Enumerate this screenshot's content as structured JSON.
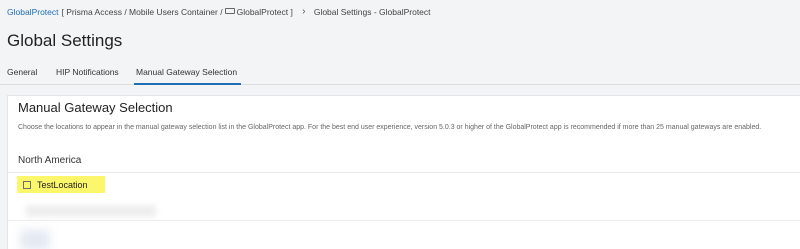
{
  "breadcrumb": {
    "root": "GlobalProtect",
    "path_start": "[ Prisma Access / Mobile Users Container /",
    "path_end": "GlobalProtect ]",
    "current": "Global Settings - GlobalProtect"
  },
  "page": {
    "title": "Global Settings"
  },
  "tabs": [
    {
      "label": "General"
    },
    {
      "label": "HIP Notifications"
    },
    {
      "label": "Manual Gateway Selection"
    }
  ],
  "section": {
    "title": "Manual Gateway Selection",
    "description": "Choose the locations to appear in the manual gateway selection list in the GlobalProtect app. For the best end user experience, version 5.0.3 or higher of the GlobalProtect app is recommended if more than 25 manual gateways are enabled.",
    "region": "North America",
    "locations": [
      {
        "label": "TestLocation",
        "checked": false
      }
    ]
  },
  "colors": {
    "link": "#1f6fb5",
    "highlight": "#fbf66a",
    "background": "#f3f4f6"
  }
}
